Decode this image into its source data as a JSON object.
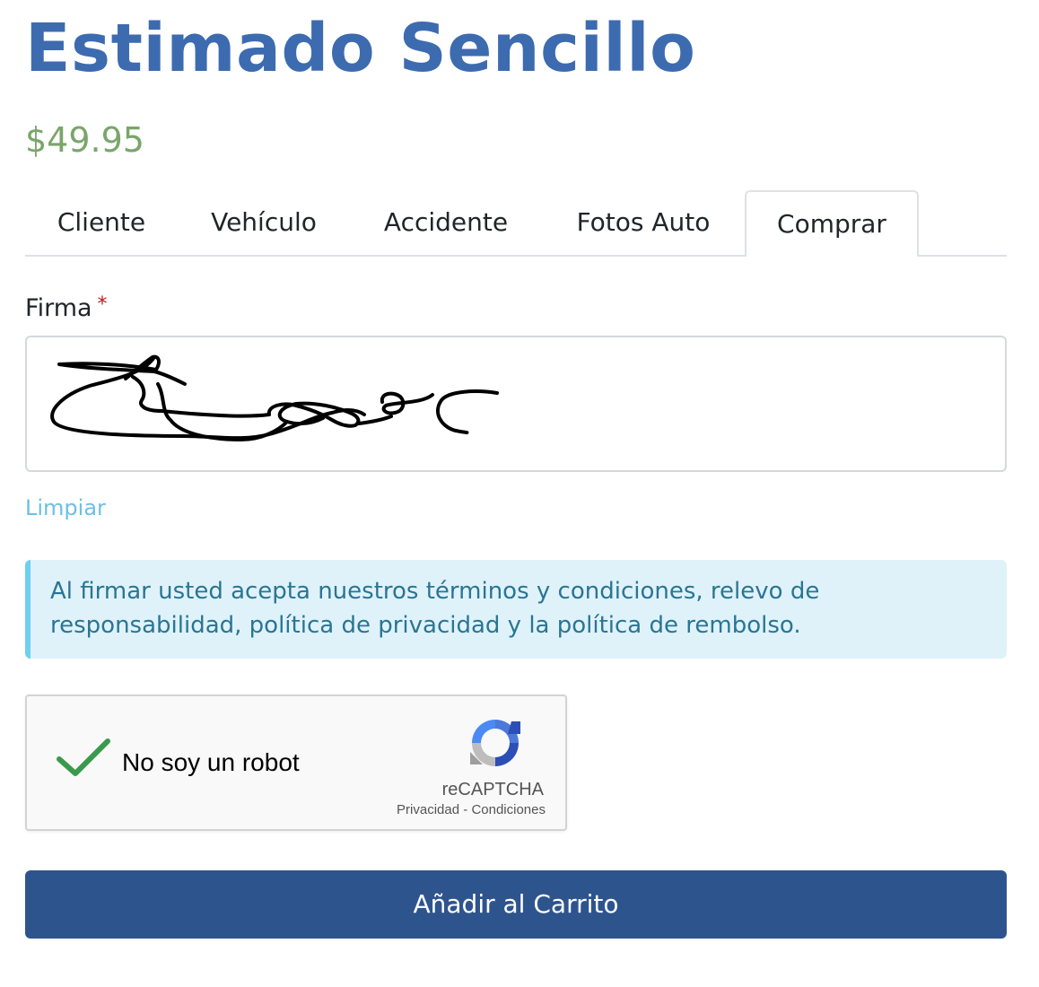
{
  "product": {
    "title": "Estimado Sencillo",
    "price": "$49.95"
  },
  "tabs": [
    {
      "label": "Cliente",
      "active": false
    },
    {
      "label": "Vehículo",
      "active": false
    },
    {
      "label": "Accidente",
      "active": false
    },
    {
      "label": "Fotos Auto",
      "active": false
    },
    {
      "label": "Comprar",
      "active": true
    }
  ],
  "signature": {
    "label": "Firma",
    "required_marker": "*",
    "clear_label": "Limpiar"
  },
  "notice": {
    "text": "Al firmar usted acepta nuestros términos y condiciones, relevo de responsabilidad, política de privacidad y la política de rembolso."
  },
  "captcha": {
    "checked": true,
    "label": "No soy un robot",
    "brand": "reCAPTCHA",
    "privacy_link": "Privacidad",
    "separator": "-",
    "terms_link": "Condiciones"
  },
  "cart": {
    "button_label": "Añadir al Carrito"
  },
  "colors": {
    "title": "#3d6bb0",
    "price": "#7aa56b",
    "link": "#6cc0e5",
    "alert_bg": "#dff2f9",
    "alert_text": "#2a7594",
    "button_bg": "#2e548e",
    "check": "#3a9a4c"
  },
  "icons": {
    "captcha_check": "check-icon",
    "captcha_logo": "recaptcha-logo-icon"
  }
}
